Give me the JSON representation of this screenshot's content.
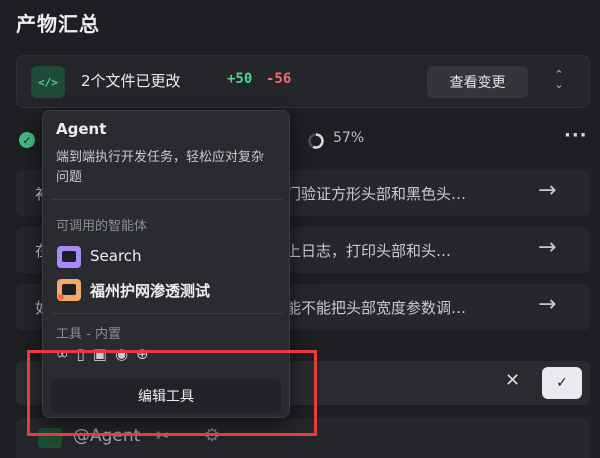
{
  "page": {
    "title": "产物汇总"
  },
  "changes": {
    "badge": "</>",
    "summary": "2个文件已更改",
    "added": "+50",
    "removed": "-56",
    "view_button": "查看变更",
    "expand_icon": "chevron-up-down-icon"
  },
  "status": {
    "done_icon": "check-circle-icon",
    "progress_percent": 57,
    "progress_label": "57%",
    "more_icon": "more-icon"
  },
  "tasks": [
    {
      "prefix": "补",
      "text": "门验证方形头部和黑色头…",
      "arrow": "→"
    },
    {
      "prefix": "在",
      "text": "上日志，打印头部和头…",
      "arrow": "→"
    },
    {
      "prefix": "如",
      "text": "能不能把头部宽度参数调…",
      "arrow": "→"
    }
  ],
  "input": {
    "cancel": "✕",
    "confirm": "✓"
  },
  "bottom": {
    "mention": "@Agent",
    "tool_icon": "tools-icon",
    "settings_icon": "gear-icon"
  },
  "popup": {
    "title": "Agent",
    "description": "端到端执行开发任务，轻松应对复杂问题",
    "agents_label": "可调用的智能体",
    "agents": [
      {
        "name": "Search",
        "icon_color": "#a78bfa"
      },
      {
        "name": "福州护网渗透测试",
        "icon_color": "#f4a96a"
      }
    ],
    "tools_label": "工具 - 内置",
    "edit_button": "编辑工具"
  },
  "colors": {
    "accent_green": "#4cd48f",
    "danger_red": "#f36a6a",
    "annotation_red": "#e63c3c",
    "background": "#1e1f23"
  }
}
